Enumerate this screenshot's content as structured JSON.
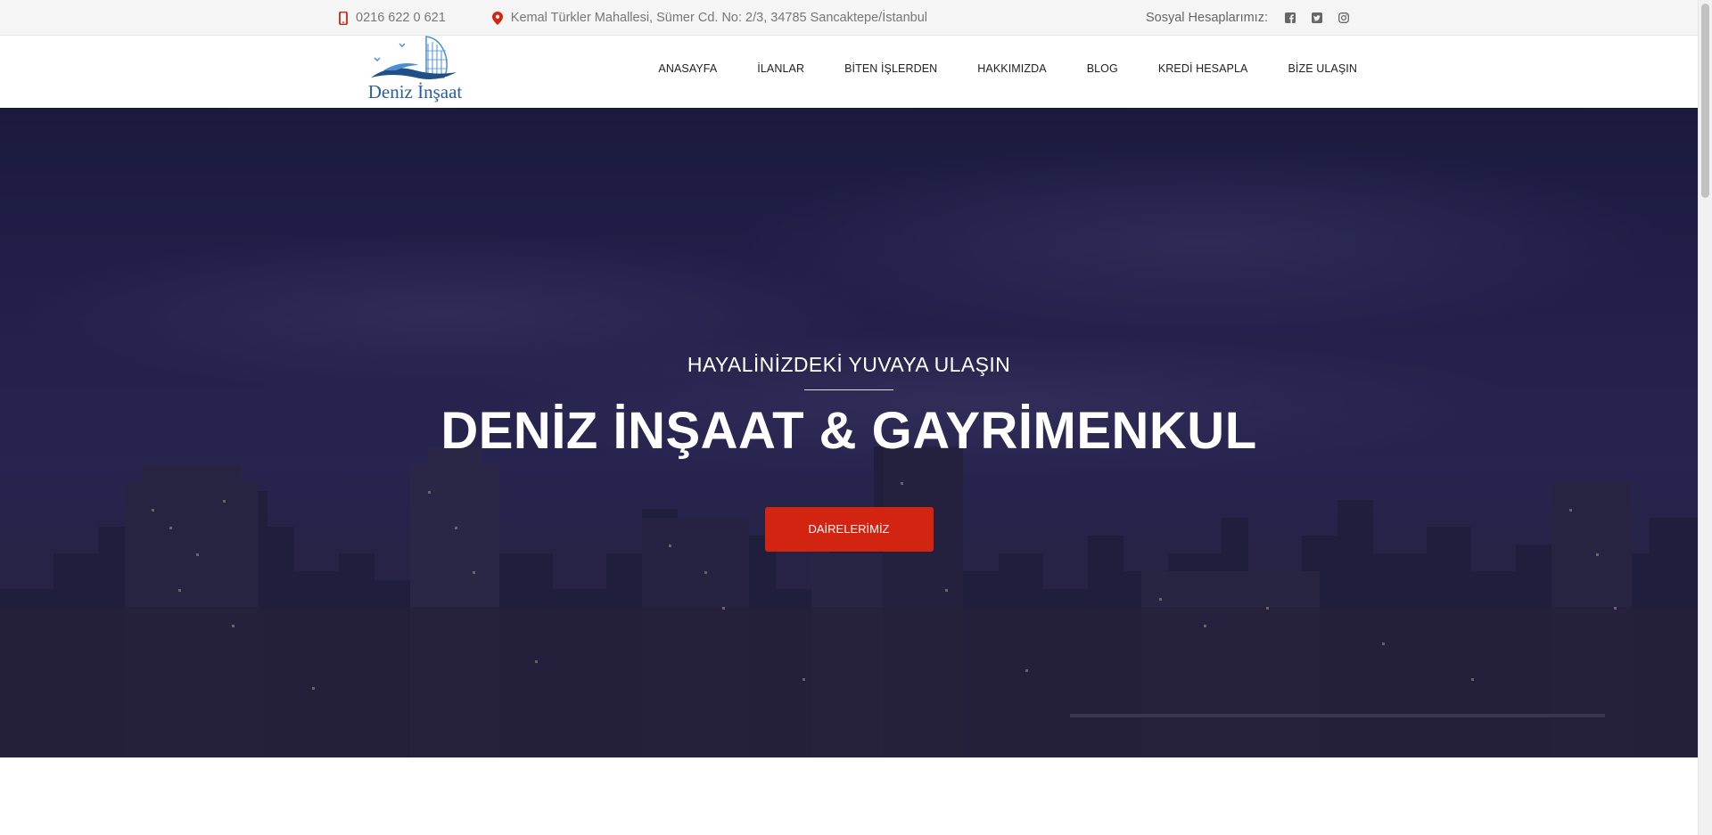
{
  "topbar": {
    "phone": "0216 622 0 621",
    "address": "Kemal Türkler Mahallesi, Sümer Cd. No: 2/3, 34785 Sancaktepe/İstanbul",
    "social_label": "Sosyal Hesaplarımız:",
    "social_icons": [
      "facebook-icon",
      "twitter-icon",
      "instagram-icon"
    ],
    "accent_color": "#d32311"
  },
  "header": {
    "logo_text": "Deniz İnşaat",
    "nav": [
      "ANASAYFA",
      "İLANLAR",
      "BİTEN İŞLERDEN",
      "HAKKIMIZDA",
      "BLOG",
      "KREDİ HESAPLA",
      "BİZE ULAŞIN"
    ]
  },
  "hero": {
    "subtitle": "HAYALİNİZDEKİ YUVAYA ULAŞIN",
    "title": "DENİZ İNŞAAT & GAYRİMENKUL",
    "button_label": "DAİRELERİMİZ",
    "button_color": "#d32311"
  }
}
